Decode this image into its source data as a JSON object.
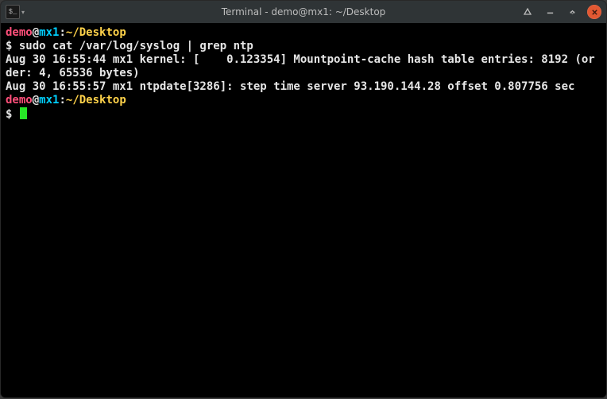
{
  "titlebar": {
    "icon_glyph": "$_",
    "title": "Terminal - demo@mx1: ~/Desktop"
  },
  "prompt": {
    "user": "demo",
    "at": "@",
    "host": "mx1",
    "colon": ":",
    "path": "~/Desktop",
    "dollar": "$ "
  },
  "lines": {
    "cmd1": "sudo cat /var/log/syslog | grep ntp",
    "out1": "Aug 30 16:55:44 mx1 kernel: [    0.123354] Mountpoint-cache hash table entries: 8192 (order: 4, 65536 bytes)",
    "out2": "Aug 30 16:55:57 mx1 ntpdate[3286]: step time server 93.190.144.28 offset 0.807756 sec"
  }
}
